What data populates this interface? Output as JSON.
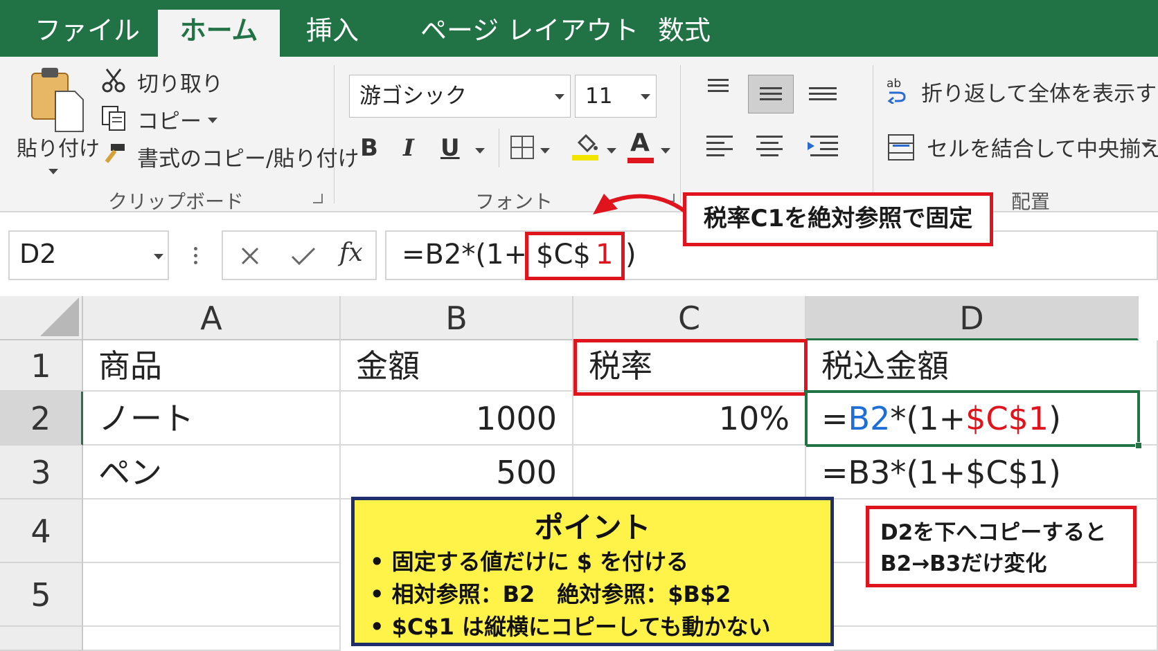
{
  "tabs": [
    {
      "label": "ファイル",
      "active": false
    },
    {
      "label": "ホーム",
      "active": true
    },
    {
      "label": "挿入",
      "active": false
    },
    {
      "label": "ページ レイアウト",
      "active": false
    },
    {
      "label": "数式",
      "active": false
    }
  ],
  "ribbon": {
    "clipboard": {
      "paste_label": "貼り付け",
      "cut_label": "切り取り",
      "copy_label": "コピー",
      "format_painter_label": "書式のコピー/貼り付け",
      "group_label": "クリップボード"
    },
    "font": {
      "font_name": "游ゴシック",
      "font_size": "11",
      "bold": "B",
      "italic": "I",
      "underline": "U",
      "font_color_glyph": "A",
      "group_label": "フォント",
      "fill_color": "#f2e600",
      "font_color": "#e0141d"
    },
    "alignment": {
      "wrap_text_label": "折り返して全体を表示する",
      "merge_center_label": "セルを結合して中央揃え",
      "group_label": "配置"
    }
  },
  "formula_bar": {
    "name_box": "D2",
    "fx": "fx",
    "formula_prefix": "=B2*(1+",
    "formula_ref_main": "$C$",
    "formula_ref_num": "1",
    "formula_suffix": ")"
  },
  "sheet": {
    "columns": [
      "A",
      "B",
      "C",
      "D"
    ],
    "rows": [
      "1",
      "2",
      "3",
      "4",
      "5"
    ],
    "cells": {
      "A1": "商品",
      "B1": "金額",
      "C1": "税率",
      "D1": "税込金額",
      "A2": "ノート",
      "B2": "1000",
      "C2": "10%",
      "D2_parts": [
        "=",
        "B2",
        "*(1+",
        "$C$1",
        ")"
      ],
      "A3": "ペン",
      "B3": "500",
      "D3": "=B3*(1+$C$1)"
    }
  },
  "annotations": {
    "top_callout": "税率C1を絶対参照で固定",
    "right_callout_line1": "D2を下へコピーすると",
    "right_callout_line2": "B2→B3だけ変化",
    "point_title": "ポイント",
    "point_items": [
      "固定する値だけに $ を付ける",
      "相対参照：B2　絶対参照：$B$2",
      "$C$1 は縦横にコピーしても動かない"
    ]
  },
  "colors": {
    "excel_green": "#217346",
    "highlight_red": "#e0141d",
    "relative_ref_blue": "#1d6fd6",
    "point_yellow": "#fff34a",
    "point_border_navy": "#1f2d6b"
  }
}
